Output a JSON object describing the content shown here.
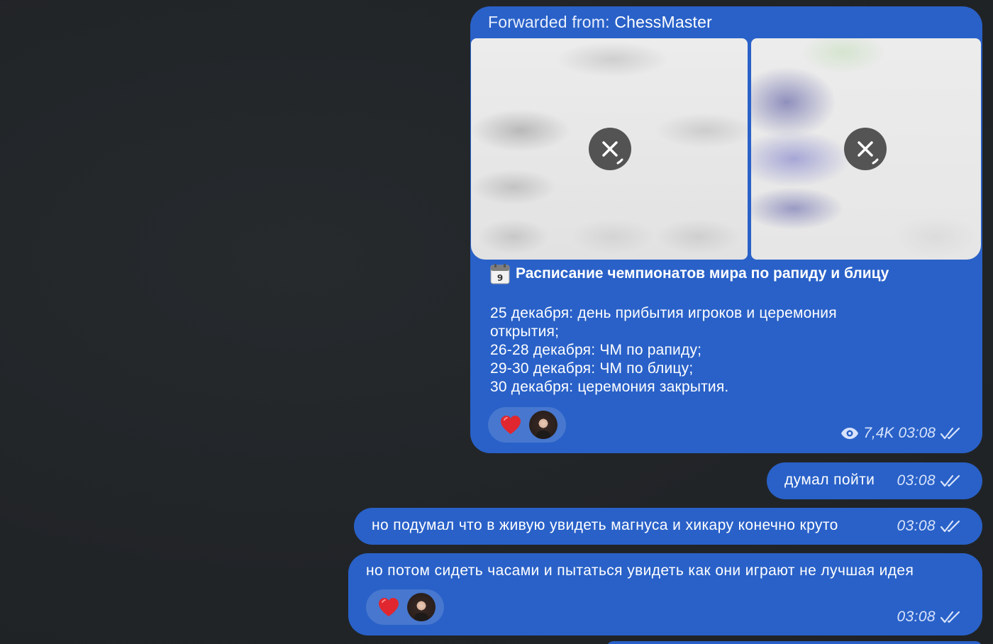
{
  "forwarded_post": {
    "forwarded_label": "Forwarded from:",
    "forwarded_name": "ChessMaster",
    "title": "Расписание чемпионатов мира по рапиду и блицу",
    "body_lines": [
      "25 декабря: день прибытия игроков и церемония",
      "открытия;",
      "26-28 декабря: ЧМ по рапиду;",
      "29-30 декабря: ЧМ по блицу;",
      "30 декабря: церемония закрытия."
    ],
    "views": "7,4K",
    "time": "03:08"
  },
  "messages": [
    {
      "text": "думал пойти",
      "time": "03:08"
    },
    {
      "text": "но подумал что в живую увидеть магнуса и хикару конечно круто",
      "time": "03:08"
    },
    {
      "text": "но потом сидеть часами и пытаться увидеть как они играют не лучшая идея",
      "time": "03:08"
    }
  ],
  "colors": {
    "bubble": "#2961c8",
    "background": "#212427",
    "meta_text": "#d8e3fb",
    "reaction_heart": "#e0262f"
  },
  "icons": [
    "close-icon",
    "calendar-icon",
    "eye-icon",
    "double-check-icon",
    "heart-reaction-icon"
  ]
}
